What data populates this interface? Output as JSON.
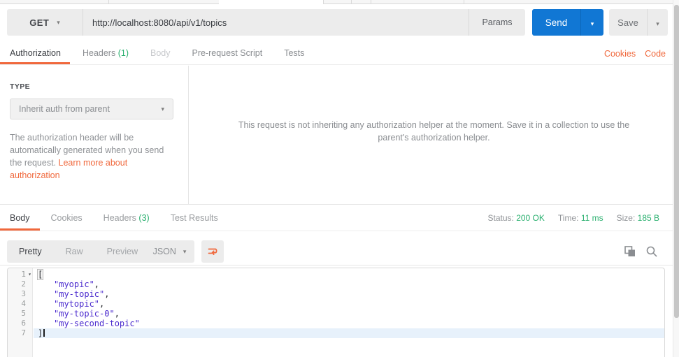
{
  "request_bar": {
    "method": "GET",
    "url": "http://localhost:8080/api/v1/topics",
    "params_label": "Params",
    "send_label": "Send",
    "save_label": "Save"
  },
  "request_tabs": {
    "authorization": "Authorization",
    "headers": "Headers",
    "headers_count": "(1)",
    "body": "Body",
    "prerequest_script": "Pre-request Script",
    "tests": "Tests"
  },
  "quick_links": {
    "cookies": "Cookies",
    "code": "Code"
  },
  "auth_panel": {
    "type_label": "TYPE",
    "type_value": "Inherit auth from parent",
    "description": "The authorization header will be automatically generated when you send the request. ",
    "link": "Learn more about authorization",
    "inherit_message": "This request is not inheriting any authorization helper at the moment. Save it in a collection to use the parent's authorization helper."
  },
  "response": {
    "tabs": {
      "body": "Body",
      "cookies": "Cookies",
      "headers": "Headers",
      "headers_count": "(3)",
      "test_results": "Test Results"
    },
    "meta": {
      "status_label": "Status:",
      "status_value": "200 OK",
      "time_label": "Time:",
      "time_value": "11 ms",
      "size_label": "Size:",
      "size_value": "185 B"
    },
    "toolbar": {
      "pretty": "Pretty",
      "raw": "Raw",
      "preview": "Preview",
      "language": "JSON"
    },
    "body_values": [
      "myopic",
      "my-topic",
      "mytopic",
      "my-topic-0",
      "my-second-topic"
    ],
    "code": {
      "lines": [
        {
          "num": "1",
          "open": "[",
          "fold": "▾"
        },
        {
          "num": "2",
          "str": "\"myopic\"",
          "tail": ","
        },
        {
          "num": "3",
          "str": "\"my-topic\"",
          "tail": ","
        },
        {
          "num": "4",
          "str": "\"mytopic\"",
          "tail": ","
        },
        {
          "num": "5",
          "str": "\"my-topic-0\"",
          "tail": ","
        },
        {
          "num": "6",
          "str": "\"my-second-topic\"",
          "tail": ""
        },
        {
          "num": "7",
          "close": "]"
        }
      ]
    }
  },
  "colors": {
    "accent_orange": "#f0683c",
    "success_green": "#2ab06f",
    "primary_blue": "#1177d4",
    "json_string": "#4b2bce"
  }
}
